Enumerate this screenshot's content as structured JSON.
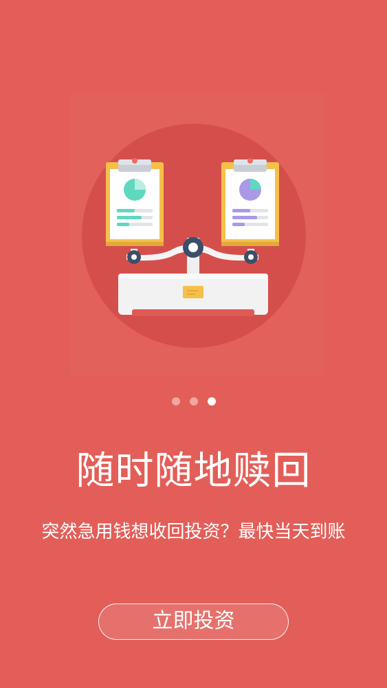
{
  "onboarding": {
    "title": "随时随地赎回",
    "subtitle": "突然急用钱想收回投资？最快当天到账",
    "cta_label": "立即投资",
    "pagination": {
      "total": 3,
      "active_index": 2
    }
  },
  "colors": {
    "background": "#e35e58",
    "circle": "#d44f4c",
    "clipboard": "#f5c04a",
    "teal_chart": "#5fd8c0",
    "purple_chart": "#a999e6",
    "scale_body": "#f2f2f2",
    "hub": "#3b4f6b"
  },
  "illustration": {
    "icon": "balance-scale-icon"
  }
}
